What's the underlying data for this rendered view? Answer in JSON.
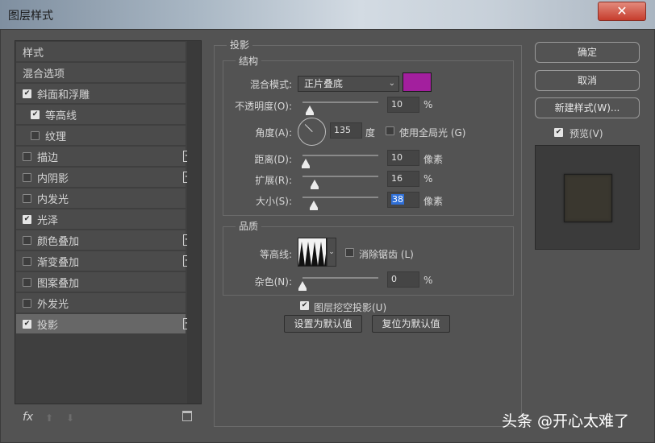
{
  "window": {
    "title": "图层样式",
    "close_glyph": "✕"
  },
  "styles_panel": {
    "items": [
      {
        "label": "样式",
        "checkbox": false,
        "checked": false,
        "plus": false,
        "indent": 0
      },
      {
        "label": "混合选项",
        "checkbox": false,
        "checked": false,
        "plus": false,
        "indent": 0
      },
      {
        "label": "斜面和浮雕",
        "checkbox": true,
        "checked": true,
        "plus": false,
        "indent": 0
      },
      {
        "label": "等高线",
        "checkbox": true,
        "checked": true,
        "plus": false,
        "indent": 1
      },
      {
        "label": "纹理",
        "checkbox": true,
        "checked": false,
        "plus": false,
        "indent": 1
      },
      {
        "label": "描边",
        "checkbox": true,
        "checked": false,
        "plus": true,
        "indent": 0
      },
      {
        "label": "内阴影",
        "checkbox": true,
        "checked": false,
        "plus": true,
        "indent": 0
      },
      {
        "label": "内发光",
        "checkbox": true,
        "checked": false,
        "plus": false,
        "indent": 0
      },
      {
        "label": "光泽",
        "checkbox": true,
        "checked": true,
        "plus": false,
        "indent": 0
      },
      {
        "label": "颜色叠加",
        "checkbox": true,
        "checked": false,
        "plus": true,
        "indent": 0
      },
      {
        "label": "渐变叠加",
        "checkbox": true,
        "checked": false,
        "plus": true,
        "indent": 0
      },
      {
        "label": "图案叠加",
        "checkbox": true,
        "checked": false,
        "plus": false,
        "indent": 0
      },
      {
        "label": "外发光",
        "checkbox": true,
        "checked": false,
        "plus": false,
        "indent": 0
      },
      {
        "label": "投影",
        "checkbox": true,
        "checked": true,
        "plus": true,
        "indent": 0,
        "active": true
      }
    ],
    "fx_label": "fx",
    "up_glyph": "⬆",
    "down_glyph": "⬇"
  },
  "drop_shadow": {
    "section_title": "投影",
    "structure": {
      "title": "结构",
      "blend_mode_label": "混合模式:",
      "blend_mode_value": "正片叠底",
      "shadow_color": "#a31f9e",
      "opacity_label": "不透明度(O):",
      "opacity_value": "10",
      "opacity_unit": "%",
      "opacity_level": 0.1,
      "angle_label": "角度(A):",
      "angle_value": "135",
      "angle_unit": "度",
      "global_light_label": "使用全局光 (G)",
      "global_light_checked": false,
      "distance_label": "距离(D):",
      "distance_value": "10",
      "distance_unit": "像素",
      "distance_level": 0.04,
      "spread_label": "扩展(R):",
      "spread_value": "16",
      "spread_unit": "%",
      "spread_level": 0.16,
      "size_label": "大小(S):",
      "size_value": "38",
      "size_unit": "像素",
      "size_level": 0.15
    },
    "quality": {
      "title": "品质",
      "contour_label": "等高线:",
      "antialias_label": "消除锯齿 (L)",
      "antialias_checked": false,
      "noise_label": "杂色(N):",
      "noise_value": "0",
      "noise_unit": "%",
      "noise_level": 0.0
    },
    "knockout_label": "图层挖空投影(U)",
    "knockout_checked": true,
    "make_default_label": "设置为默认值",
    "reset_default_label": "复位为默认值"
  },
  "right_buttons": {
    "ok_label": "确定",
    "cancel_label": "取消",
    "new_style_label": "新建样式(W)...",
    "preview_label": "预览(V)",
    "preview_checked": true
  },
  "watermark": "头条 @开心太难了",
  "chevron_glyph": "⌄",
  "check_glyph": "✔",
  "plus_glyph": "+"
}
